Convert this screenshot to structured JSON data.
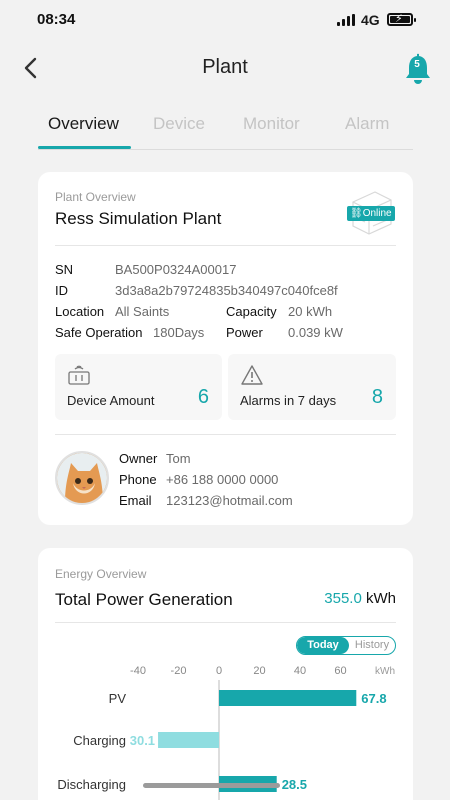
{
  "status_bar": {
    "time": "08:34",
    "network": "4G"
  },
  "nav": {
    "title": "Plant",
    "notification_count": "5"
  },
  "tabs": [
    {
      "label": "Overview",
      "active": true
    },
    {
      "label": "Device",
      "active": false
    },
    {
      "label": "Monitor",
      "active": false
    },
    {
      "label": "Alarm",
      "active": false
    }
  ],
  "plant_overview": {
    "section_label": "Plant Overview",
    "name": "Ress Simulation Plant",
    "status": "Online",
    "sn_label": "SN",
    "sn": "BA500P0324A00017",
    "id_label": "ID",
    "id": "3d3a8a2b79724835b340497c040fce8f",
    "location_label": "Location",
    "location": "All Saints",
    "capacity_label": "Capacity",
    "capacity": "20 kWh",
    "safe_operation_label": "Safe Operation",
    "safe_operation": "180Days",
    "power_label": "Power",
    "power": "0.039 kW",
    "device_amount_label": "Device Amount",
    "device_amount": "6",
    "alarms_label": "Alarms in 7 days",
    "alarms": "8",
    "owner_label": "Owner",
    "owner": "Tom",
    "phone_label": "Phone",
    "phone": "+86 188 0000 0000",
    "email_label": "Email",
    "email": "123123@hotmail.com"
  },
  "energy_overview": {
    "section_label": "Energy Overview",
    "title": "Total Power Generation",
    "value": "355.0",
    "unit": "kWh",
    "toggle_today": "Today",
    "toggle_history": "History"
  },
  "colors": {
    "accent": "#17a7ab",
    "accent_light": "#8fdde0",
    "background": "#f2f2f2"
  },
  "chart_data": {
    "type": "bar",
    "orientation": "horizontal",
    "categories": [
      "PV",
      "Charging",
      "Discharging"
    ],
    "values": [
      67.8,
      -30.1,
      28.5
    ],
    "value_labels": [
      "67.8",
      "30.1",
      "28.5"
    ],
    "x_ticks": [
      "-40",
      "-20",
      "0",
      "20",
      "40",
      "60"
    ],
    "x_tick_values": [
      -40,
      -20,
      0,
      20,
      40,
      60
    ],
    "unit_label": "kWh",
    "xlim": [
      -40,
      70
    ],
    "grid": false
  }
}
